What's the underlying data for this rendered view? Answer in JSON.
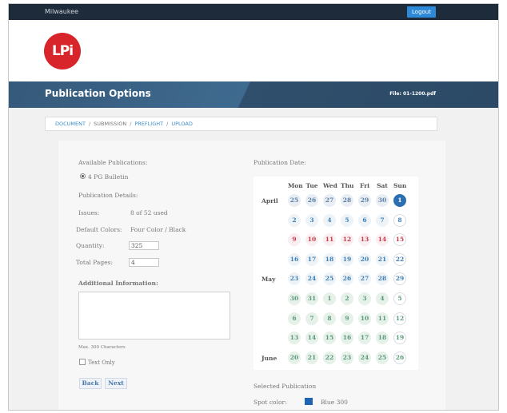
{
  "topbar": {
    "user": "Milwaukee",
    "logout_label": "Logout"
  },
  "logo": {
    "text": "LPi"
  },
  "banner": {
    "title": "Publication Options",
    "file": "File: 01-1200.pdf"
  },
  "breadcrumb": {
    "items": [
      "DOCUMENT",
      "SUBMISSION",
      "PREFLIGHT",
      "UPLOAD"
    ],
    "separator": "/"
  },
  "form": {
    "available_publications_label": "Available Publications:",
    "publication_option": "4 PG Bulletin",
    "publication_details_label": "Publication Details:",
    "issues_label": "Issues:",
    "issues_value": "8 of 52 used",
    "default_colors_label": "Default Colors:",
    "default_colors_value": "Four Color / Black",
    "quantity_label": "Quantity:",
    "quantity_value": "325",
    "total_pages_label": "Total Pages:",
    "total_pages_value": "4",
    "additional_info_label": "Additional Information:",
    "max_chars": "Max. 300 Characters",
    "text_only_label": "Text Only",
    "back_label": "Back",
    "next_label": "Next"
  },
  "calendar": {
    "label": "Publication Date:",
    "weekdays": [
      "Mon",
      "Tue",
      "Wed",
      "Thu",
      "Fri",
      "Sat",
      "Sun"
    ],
    "months": [
      {
        "name": "April",
        "row": 0
      },
      {
        "name": "May",
        "row": 4
      },
      {
        "name": "June",
        "row": 8
      }
    ],
    "rows": [
      [
        {
          "d": "25",
          "s": "a"
        },
        {
          "d": "26",
          "s": "a"
        },
        {
          "d": "27",
          "s": "a"
        },
        {
          "d": "28",
          "s": "a"
        },
        {
          "d": "29",
          "s": "a"
        },
        {
          "d": "30",
          "s": "a"
        },
        {
          "d": "1",
          "s": "sel"
        }
      ],
      [
        {
          "d": "2",
          "s": "m"
        },
        {
          "d": "3",
          "s": "m"
        },
        {
          "d": "4",
          "s": "m"
        },
        {
          "d": "5",
          "s": "m"
        },
        {
          "d": "6",
          "s": "m"
        },
        {
          "d": "7",
          "s": "m"
        },
        {
          "d": "8",
          "s": "m ring"
        }
      ],
      [
        {
          "d": "9",
          "s": "r"
        },
        {
          "d": "10",
          "s": "r"
        },
        {
          "d": "11",
          "s": "r"
        },
        {
          "d": "12",
          "s": "r"
        },
        {
          "d": "13",
          "s": "r"
        },
        {
          "d": "14",
          "s": "r"
        },
        {
          "d": "15",
          "s": "r ring"
        }
      ],
      [
        {
          "d": "16",
          "s": "m"
        },
        {
          "d": "17",
          "s": "m"
        },
        {
          "d": "18",
          "s": "m"
        },
        {
          "d": "19",
          "s": "m"
        },
        {
          "d": "20",
          "s": "m"
        },
        {
          "d": "21",
          "s": "m"
        },
        {
          "d": "22",
          "s": "m ring"
        }
      ],
      [
        {
          "d": "23",
          "s": "m"
        },
        {
          "d": "24",
          "s": "m"
        },
        {
          "d": "25",
          "s": "m"
        },
        {
          "d": "26",
          "s": "m"
        },
        {
          "d": "27",
          "s": "m"
        },
        {
          "d": "28",
          "s": "m"
        },
        {
          "d": "29",
          "s": "m ring"
        }
      ],
      [
        {
          "d": "30",
          "s": "g"
        },
        {
          "d": "31",
          "s": "g"
        },
        {
          "d": "1",
          "s": "g"
        },
        {
          "d": "2",
          "s": "g"
        },
        {
          "d": "3",
          "s": "g"
        },
        {
          "d": "4",
          "s": "g"
        },
        {
          "d": "5",
          "s": "g ring"
        }
      ],
      [
        {
          "d": "6",
          "s": "g"
        },
        {
          "d": "7",
          "s": "g"
        },
        {
          "d": "8",
          "s": "g"
        },
        {
          "d": "9",
          "s": "g"
        },
        {
          "d": "10",
          "s": "g"
        },
        {
          "d": "11",
          "s": "g"
        },
        {
          "d": "12",
          "s": "g ring"
        }
      ],
      [
        {
          "d": "13",
          "s": "g"
        },
        {
          "d": "14",
          "s": "g"
        },
        {
          "d": "15",
          "s": "g"
        },
        {
          "d": "16",
          "s": "g"
        },
        {
          "d": "17",
          "s": "g"
        },
        {
          "d": "18",
          "s": "g"
        },
        {
          "d": "19",
          "s": "g ring"
        }
      ],
      [
        {
          "d": "20",
          "s": "g"
        },
        {
          "d": "21",
          "s": "g"
        },
        {
          "d": "22",
          "s": "g"
        },
        {
          "d": "23",
          "s": "g"
        },
        {
          "d": "24",
          "s": "g"
        },
        {
          "d": "25",
          "s": "g"
        },
        {
          "d": "26",
          "s": "g ring"
        }
      ]
    ]
  },
  "selected": {
    "label": "Selected Publication",
    "spot_color_label": "Spot color:",
    "spot_color_value": "Blue 300",
    "swatch_color": "#1f63b5"
  },
  "colors": {
    "topbar": "#1d2b3a",
    "banner": "#35597a",
    "accent": "#2e8ad8",
    "logo": "#d8252b"
  }
}
